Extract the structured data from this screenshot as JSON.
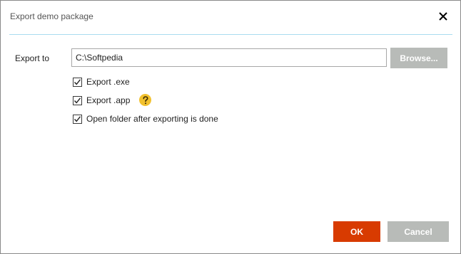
{
  "dialog": {
    "title": "Export demo package",
    "close_icon": "close-icon"
  },
  "export": {
    "label": "Export to",
    "path_value": "C:\\Softpedia",
    "browse_label": "Browse..."
  },
  "options": [
    {
      "label": "Export .exe",
      "checked": true
    },
    {
      "label": "Export .app",
      "checked": true,
      "help_icon": "question-mark-icon"
    },
    {
      "label": "Open folder after exporting is done",
      "checked": true
    }
  ],
  "buttons": {
    "ok_label": "OK",
    "cancel_label": "Cancel"
  },
  "colors": {
    "accent": "#d83b01",
    "secondary_button": "#b8bbb8",
    "title_rule": "#a9dcef",
    "help_icon": "#f2c12e"
  }
}
